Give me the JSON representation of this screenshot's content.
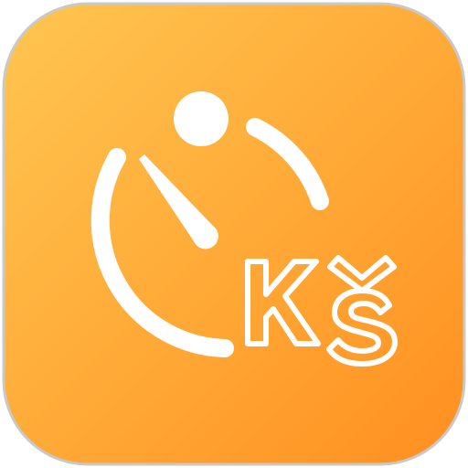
{
  "app_icon": {
    "semantic": "timer-with-kcs-badge-icon",
    "logo_text": "Kš",
    "colors": {
      "gradient_start": "#FFC651",
      "gradient_end": "#FF8F1F",
      "glyph": "#FFFFFF",
      "border": "#C9C9C9"
    }
  }
}
